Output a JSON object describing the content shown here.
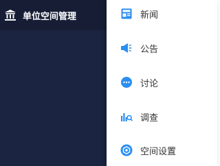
{
  "left_nav": {
    "title": "单位空间管理",
    "icon": "institution-icon",
    "background": "#1b2440",
    "header_background": "#161d35"
  },
  "menu": {
    "accent_color": "#2b8ef0",
    "items": [
      {
        "label": "新闻",
        "icon": "news-icon"
      },
      {
        "label": "公告",
        "icon": "megaphone-icon"
      },
      {
        "label": "讨论",
        "icon": "chat-bubble-icon"
      },
      {
        "label": "调查",
        "icon": "survey-chart-icon"
      },
      {
        "label": "空间设置",
        "icon": "settings-gear-icon"
      }
    ]
  }
}
